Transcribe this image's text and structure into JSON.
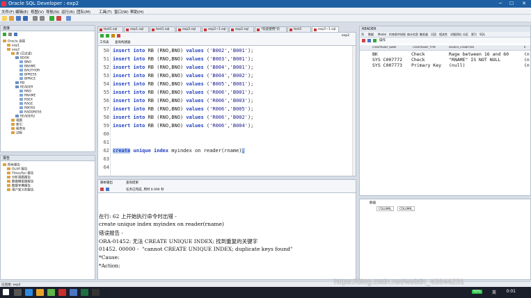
{
  "window": {
    "title": "Oracle SQL Developer : exp2",
    "controls": [
      "─",
      "☐",
      "✕"
    ]
  },
  "menu": [
    "文件(F)",
    "编辑(E)",
    "视图(V)",
    "导航(N)",
    "运行(R)",
    "团队(M)",
    "工具(T)",
    "窗口(W)",
    "帮助(H)"
  ],
  "left_panel": {
    "title": "连接",
    "tree": [
      {
        "label": "Oracle 连接",
        "depth": 0
      },
      {
        "label": "exp1",
        "depth": 1
      },
      {
        "label": "exp2",
        "depth": 1
      },
      {
        "label": "表 (已过滤)",
        "depth": 2
      },
      {
        "label": "BOOK",
        "depth": 3
      },
      {
        "label": "BNO",
        "depth": 4
      },
      {
        "label": "BNAME",
        "depth": 4
      },
      {
        "label": "BAUTHOR",
        "depth": 4
      },
      {
        "label": "BPRESS",
        "depth": 4
      },
      {
        "label": "BPRICE",
        "depth": 4
      },
      {
        "label": "RB",
        "depth": 3
      },
      {
        "label": "READER",
        "depth": 3
      },
      {
        "label": "RNO",
        "depth": 4
      },
      {
        "label": "RNAME",
        "depth": 4
      },
      {
        "label": "RSEX",
        "depth": 4
      },
      {
        "label": "RAGE",
        "depth": 4
      },
      {
        "label": "RBOSS",
        "depth": 4
      },
      {
        "label": "RADDRESS",
        "depth": 4
      },
      {
        "label": "READER2",
        "depth": 3
      },
      {
        "label": "视图",
        "depth": 2
      },
      {
        "label": "索引",
        "depth": 2
      },
      {
        "label": "程序包",
        "depth": 2
      },
      {
        "label": "过程",
        "depth": 2
      }
    ]
  },
  "reports_panel": {
    "title": "报告",
    "items": [
      "所有报告",
      "OLAP 报告",
      "TimesTen 报告",
      "分析视图报告",
      "数据模型器报告",
      "数据字典报告",
      "用户定义的报告"
    ]
  },
  "tabs": [
    "test1.sql",
    "exp1.sql",
    "test1.sql",
    "exp2.sql",
    "exp2~1.sql",
    "exp2.sql",
    "*欢迎使用*页",
    "test1",
    "exp2~1.sql"
  ],
  "active_tab_index": 8,
  "editor_header": {
    "worksheet": "工作表",
    "query_builder": "查询构建器",
    "connection": "exp2"
  },
  "editor_lines": [
    {
      "n": "50",
      "rno": "'B002'",
      "bno": "'B001'"
    },
    {
      "n": "51",
      "rno": "'B003'",
      "bno": "'B001'"
    },
    {
      "n": "52",
      "rno": "'B004'",
      "bno": "'B001'"
    },
    {
      "n": "53",
      "rno": "'B004'",
      "bno": "'B002'"
    },
    {
      "n": "54",
      "rno": "'B005'",
      "bno": "'B001'"
    },
    {
      "n": "55",
      "rno": "'R006'",
      "bno": "'B001'"
    },
    {
      "n": "56",
      "rno": "'R006'",
      "bno": "'B003'"
    },
    {
      "n": "57",
      "rno": "'R006'",
      "bno": "'B005'"
    },
    {
      "n": "58",
      "rno": "'R006'",
      "bno": "'B002'"
    },
    {
      "n": "59",
      "rno": "'R006'",
      "bno": "'B004'"
    }
  ],
  "insert_stmt": {
    "kw1": "insert",
    "kw2": "into",
    "table": "RB",
    "cols": "(RNO,BNO)",
    "kw3": "values"
  },
  "empty_lines": [
    "60",
    "61",
    "63",
    "64"
  ],
  "create_line": {
    "n": "62",
    "create": "create",
    "rest_kw": "unique index",
    "rest": " myindex on reader(rname)",
    "end": ";"
  },
  "output_header": {
    "tab1": "脚本输出",
    "tab2": "查询结果",
    "status": "任务已完成, 用时 0.094 秒"
  },
  "output_lines": [
    "在行: 62 上开始执行命令时出错 -",
    "create unique index myindex on reader(rname)",
    "错误报告 -",
    "ORA-01452: 无法 CREATE UNIQUE INDEX; 找到重复的关键字",
    "01452. 00000 -  \"cannot CREATE UNIQUE INDEX; duplicate keys found\"",
    "*Cause:",
    "*Action:"
  ],
  "right_panel": {
    "title": "READER",
    "tabs": [
      "列",
      "数据",
      "Model",
      "约束条件",
      "授权",
      "统计信息",
      "触发器",
      "闪回",
      "相关性",
      "详细资料",
      "分区",
      "索引",
      "SQL"
    ],
    "tool_label": "操作",
    "constraint_headers": [
      "CONSTRAINT_NAME",
      "CONSTRAINT_TYPE",
      "SEARCH_CONDITION",
      "R"
    ],
    "constraints": [
      {
        "name": "BK",
        "type": "Check",
        "cond": "Rage between 16 and 60",
        "r": "(n"
      },
      {
        "name": "SYS C007772",
        "type": "Check",
        "cond": "\"RNAME\" IS NOT NULL",
        "r": "(n"
      },
      {
        "name": "SYS C007773",
        "type": "Primary Key",
        "cond": "(null)",
        "r": "(n"
      }
    ]
  },
  "bottom_right": {
    "label": "额器",
    "col1": "COLUMN_",
    "col2": "COLUMN_"
  },
  "statusbar": {
    "text": "已连接: exp2"
  },
  "taskbar": {
    "battery": "50%",
    "lang": "英",
    "time": "0:01"
  },
  "watermark": "https://blog.csdn.net/weixin_43644231",
  "colors": {
    "titlebar": "#1f5fa3",
    "keyword": "#1f3fbf",
    "selection": "#b7cdf0"
  }
}
